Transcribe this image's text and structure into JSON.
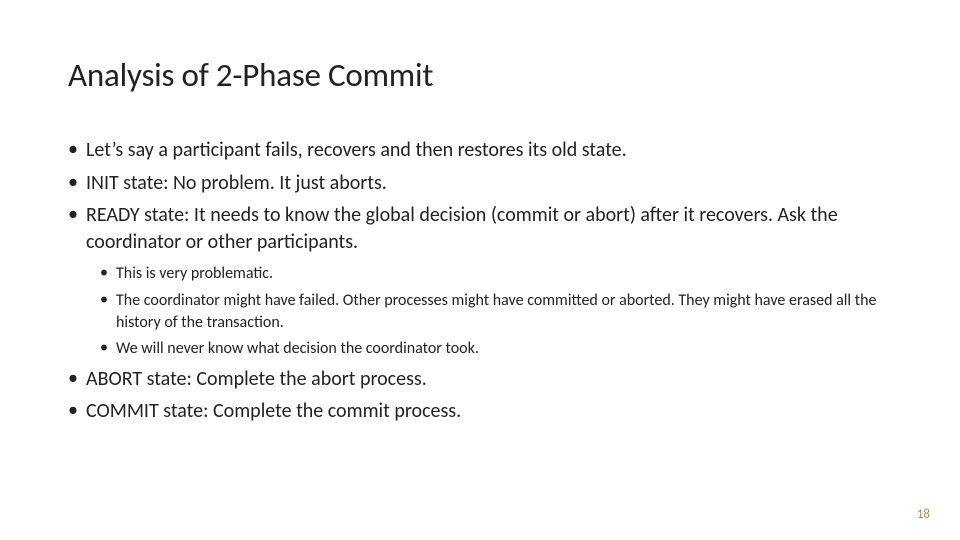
{
  "title": "Analysis of 2-Phase Commit",
  "bullets": {
    "b1": "Let’s say a participant fails, recovers and then restores its old state.",
    "b2": "INIT state: No problem. It just aborts.",
    "b3": "READY state: It needs to know the global decision (commit or abort) after it recovers. Ask the coordinator or other participants.",
    "b3_sub": {
      "s1": "This is very problematic.",
      "s2": "The coordinator might have failed. Other processes might have committed or aborted. They might have erased all the history of the transaction.",
      "s3": "We will never know what decision the coordinator took."
    },
    "b4": "ABORT state: Complete the abort process.",
    "b5": "COMMIT state: Complete the commit process."
  },
  "page_number": "18"
}
